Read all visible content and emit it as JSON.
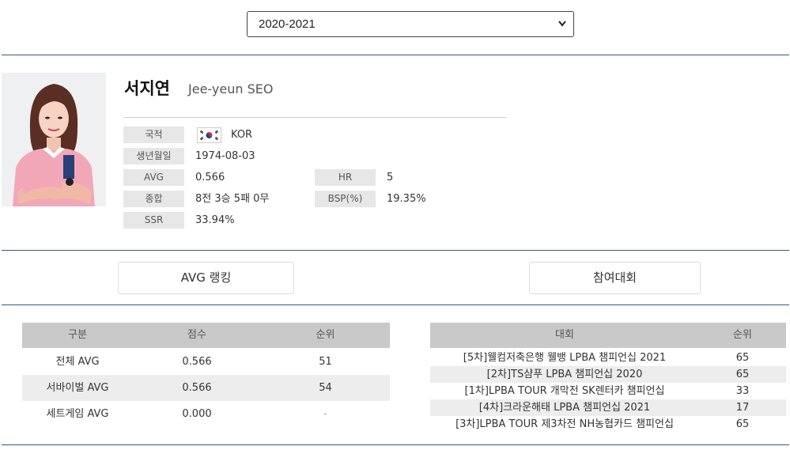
{
  "season_select": {
    "value": "2020-2021"
  },
  "player": {
    "name_kr": "서지연",
    "name_en": "Jee-yeun SEO",
    "info": {
      "nationality_label": "국적",
      "nationality_value": "KOR",
      "birth_label": "생년월일",
      "birth_value": "1974-08-03",
      "avg_label": "AVG",
      "avg_value": "0.566",
      "record_label": "종합",
      "record_value": "8전 3승 5패 0무",
      "ssr_label": "SSR",
      "ssr_value": "33.94%",
      "hr_label": "HR",
      "hr_value": "5",
      "bsp_label": "BSP(%)",
      "bsp_value": "19.35%"
    }
  },
  "tabs": {
    "avg_ranking": "AVG 랭킹",
    "participation": "참여대회"
  },
  "avg_table": {
    "headers": [
      "구분",
      "점수",
      "순위"
    ],
    "rows": [
      [
        "전체 AVG",
        "0.566",
        "51"
      ],
      [
        "서바이벌 AVG",
        "0.566",
        "54"
      ],
      [
        "세트게임 AVG",
        "0.000",
        "-"
      ]
    ]
  },
  "tournament_table": {
    "headers": [
      "대회",
      "순위"
    ],
    "rows": [
      [
        "[5차]웰컴저축은행 웰뱅 LPBA 챔피언십 2021",
        "65"
      ],
      [
        "[2차]TS샴푸 LPBA 챔피언십 2020",
        "65"
      ],
      [
        "[1차]LPBA TOUR 개막전 SK렌터카 챔피언십",
        "33"
      ],
      [
        "[4차]크라운해태 LPBA 챔피언십 2021",
        "17"
      ],
      [
        "[3차]LPBA TOUR 제3차전 NH농협카드 챔피언십",
        "65"
      ]
    ]
  },
  "icons": {
    "dropdown": "chevron-down-icon",
    "flag": "korea-flag-icon",
    "photo": "player-photo"
  }
}
